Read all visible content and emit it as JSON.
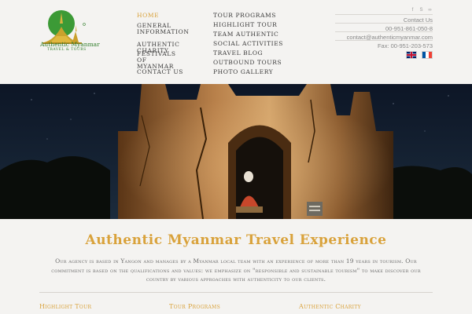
{
  "brand": {
    "name": "Authentic Myanmar",
    "tagline": "TRAVEL & TOURS"
  },
  "nav": {
    "col1": [
      "Home",
      "General Information",
      "Authentic Charity",
      "Festivals of Myanmar",
      "Contact Us"
    ],
    "col2": [
      "Tour programs",
      "Highlight Tour",
      "Team authentic",
      "Social activities",
      "Travel Blog",
      "Outbound Tours",
      "Photo Gallery"
    ]
  },
  "contact": {
    "social_icons": [
      "facebook-icon",
      "skype-icon",
      "tripadvisor-icon"
    ],
    "lines": [
      "Contact Us",
      "00-951-861-050-8",
      "contact@authenticmyanmar.com",
      "Fax: 00-951-203-573"
    ]
  },
  "languages": [
    "english-flag",
    "french-flag"
  ],
  "intro": {
    "title": "Authentic Myanmar Travel Experience",
    "text": "Our agency is based in Yangon and manages by a Myanmar local team with an experience of more than 19 years in tourism. Our commitment is based on the qualifications and values: we emphasize on \"responsible and sustainable tourism\" to make discover our country by various approaches with authenticity to our clients."
  },
  "bottom_links": [
    "Highlight Tour",
    "Tour Programs",
    "Authentic Charity"
  ],
  "colors": {
    "accent": "#d9a23b",
    "background": "#f4f3f1",
    "brand_green": "#2f7d2a"
  }
}
